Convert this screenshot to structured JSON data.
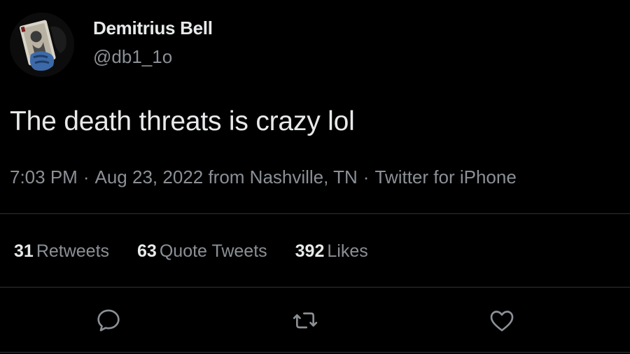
{
  "user": {
    "display_name": "Demitrius Bell",
    "handle": "@db1_1o",
    "avatar_icon": "joker-card-avatar"
  },
  "tweet": {
    "text": "The death threats is crazy lol",
    "time": "7:03 PM",
    "date": "Aug 23, 2022",
    "location": "from Nashville, TN",
    "source": "Twitter for iPhone",
    "separator": "·"
  },
  "stats": [
    {
      "count": "31",
      "label": "Retweets"
    },
    {
      "count": "63",
      "label": "Quote Tweets"
    },
    {
      "count": "392",
      "label": "Likes"
    }
  ],
  "actions": [
    {
      "name": "reply",
      "icon": "speech-bubble-icon"
    },
    {
      "name": "retweet",
      "icon": "retweet-arrows-icon"
    },
    {
      "name": "like",
      "icon": "heart-icon"
    }
  ],
  "colors": {
    "background": "#000000",
    "primary_text": "#e7e9ea",
    "secondary_text": "#8b9096",
    "divider": "#2f3336"
  }
}
